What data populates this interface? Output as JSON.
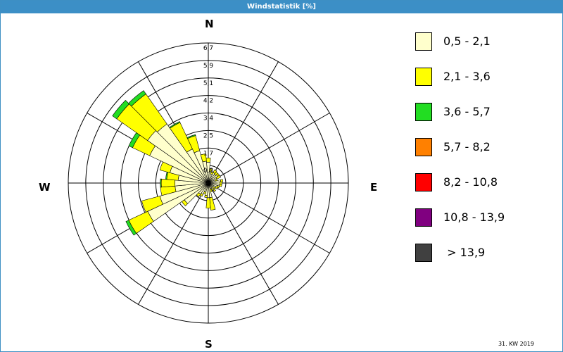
{
  "window": {
    "title": "Windstatistik [%]",
    "footer": "31. KW 2019"
  },
  "compass": {
    "n": "N",
    "e": "E",
    "s": "S",
    "w": "W"
  },
  "legend": [
    {
      "label": "0,5 - 2,1",
      "color": "#ffffcc"
    },
    {
      "label": "2,1 - 3,6",
      "color": "#ffff00"
    },
    {
      "label": "3,6 - 5,7",
      "color": "#22dd22"
    },
    {
      "label": "5,7 - 8,2",
      "color": "#ff8000"
    },
    {
      "label": "8,2 - 10,8",
      "color": "#ff0000"
    },
    {
      "label": "10,8 - 13,9",
      "color": "#800080"
    },
    {
      "label": " > 13,9",
      "color": "#404040"
    }
  ],
  "chart_data": {
    "type": "wind-rose",
    "title": "Windstatistik [%]",
    "unit": "%",
    "radial_tick_labels": [
      "0,8",
      "1,7",
      "2,5",
      "3,4",
      "4,2",
      "5,1",
      "5,9",
      "6,7"
    ],
    "rmax": 6.7,
    "sector_width_deg": 10,
    "speed_classes": [
      "0,5 - 2,1",
      "2,1 - 3,6",
      "3,6 - 5,7",
      "5,7 - 8,2",
      "8,2 - 10,8",
      "10,8 - 13,9",
      "> 13,9"
    ],
    "series": [
      {
        "name": "0,5 - 2,1",
        "color": "#ffffcc",
        "values": [
          1.0,
          0.55,
          0.45,
          0.55,
          0.5,
          0.55,
          0.45,
          0.35,
          0.6,
          0.55,
          0.55,
          0.45,
          0.4,
          0.3,
          0.4,
          0.3,
          0.3,
          0.7,
          0.7,
          0.6,
          0.45,
          0.6,
          0.65,
          1.4,
          3.2,
          2.4,
          1.6,
          1.6,
          1.45,
          1.9,
          3.1,
          3.55,
          3.45,
          1.8,
          1.6,
          1.05
        ]
      },
      {
        "name": "2,1 - 3,6",
        "color": "#ffff00",
        "values": [
          0.2,
          0.15,
          0.1,
          0.15,
          0.15,
          0.1,
          0.2,
          0.1,
          0.1,
          0.1,
          0.1,
          0.1,
          0.1,
          0.1,
          0.1,
          0.1,
          0.15,
          0.6,
          0.5,
          0.1,
          0.1,
          0.1,
          0.15,
          0.15,
          1.0,
          0.9,
          0.7,
          0.65,
          0.55,
          0.5,
          0.9,
          1.8,
          1.75,
          1.4,
          0.75,
          0.35
        ]
      },
      {
        "name": "3,6 - 5,7",
        "color": "#22dd22",
        "values": [
          0.0,
          0.0,
          0.0,
          0.0,
          0.0,
          0.0,
          0.0,
          0.0,
          0.0,
          0.0,
          0.0,
          0.0,
          0.0,
          0.0,
          0.0,
          0.0,
          0.0,
          0.0,
          0.0,
          0.0,
          0.0,
          0.0,
          0.0,
          0.0,
          0.15,
          0.0,
          0.0,
          0.05,
          0.05,
          0.0,
          0.2,
          0.25,
          0.2,
          0.05,
          0.05,
          0.0
        ]
      }
    ]
  }
}
